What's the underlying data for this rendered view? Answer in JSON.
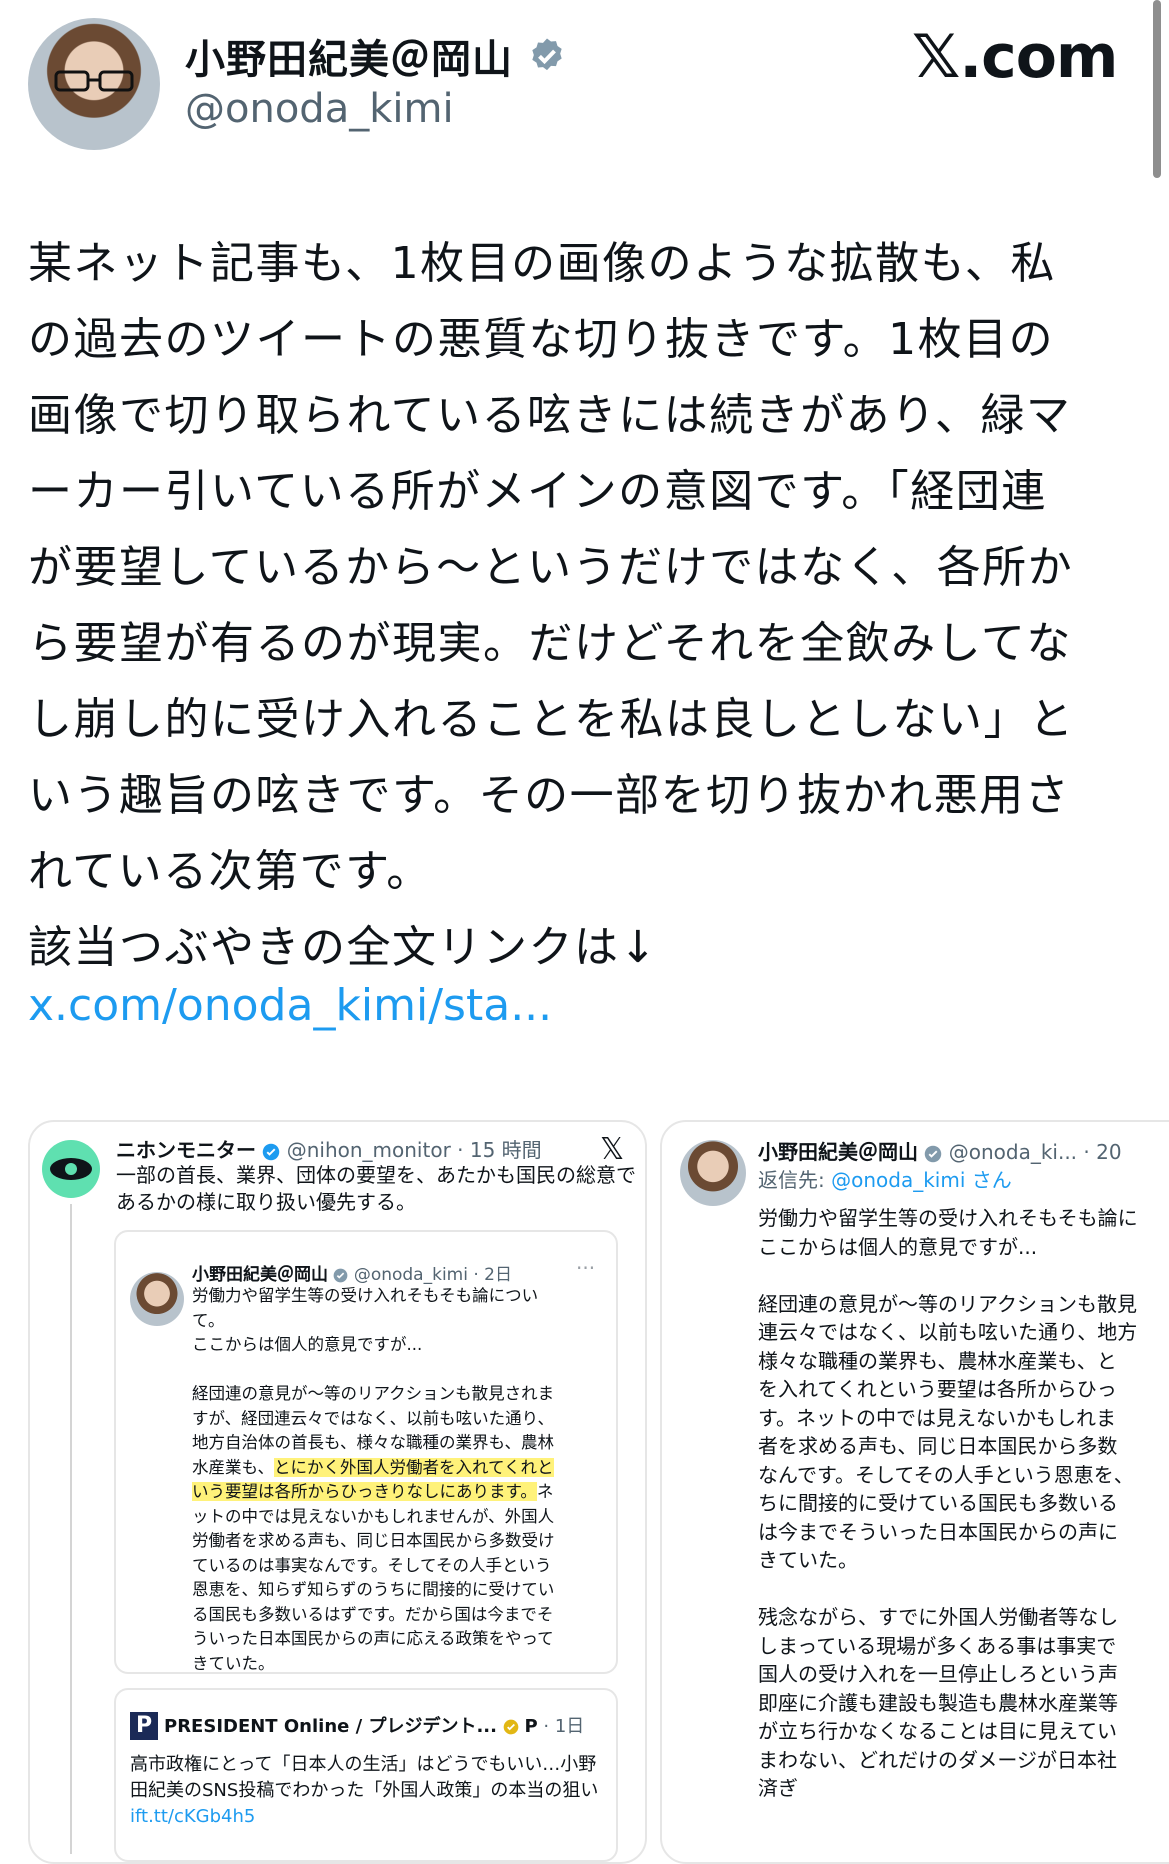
{
  "header": {
    "name": "小野田紀美＠岡山",
    "handle": "@onoda_kimi",
    "site": "𝕏.com"
  },
  "tweet": {
    "text": "某ネット記事も、1枚目の画像のような拡散も、私\nの過去のツイートの悪質な切り抜きです。1枚目の\n画像で切り取られている呟きには続きがあり、緑マ\nーカー引いている所がメインの意図です。「経団連\nが要望しているから〜というだけではなく、各所か\nら要望が有るのが現実。だけどそれを全飲みしてな\nし崩し的に受け入れることを私は良しとしない」と\nいう趣旨の呟きです。その一部を切り抜かれ悪用さ\nれている次第です。\n該当つぶやきの全文リンクは↓",
    "link": "x.com/onoda_kimi/sta..."
  },
  "left_card": {
    "author": "ニホンモニター",
    "handle": "@nihon_monitor",
    "time": "· 15 時間",
    "x_icon": "𝕏",
    "text": "一部の首長、業界、団体の要望を、あたかも国民の総意であるかの様に取り扱い優先する。",
    "quote": {
      "author": "小野田紀美＠岡山",
      "handle": "@onoda_kimi",
      "time": "· 2日",
      "dots": "···",
      "text_before": "労働力や留学生等の受け入れそもそも論につい\nて。\nここからは個人的意見ですが...\n\n経団連の意見が〜等のリアクションも散見されま\nすが、経団連云々ではなく、以前も呟いた通り、\n地方自治体の首長も、様々な職種の業界も、農林\n水産業も、",
      "highlight": "とにかく外国人労働者を入れてくれと\nいう要望は各所からひっきりなしにあります。",
      "text_after": "ネ\nットの中では見えないかもしれませんが、外国人\n労働者を求める声も、同じ日本国民から多数受け\nているのは事実なんです。そしてその人手という\n恩恵を、知らず知らずのうちに間接的に受けてい\nる国民も多数いるはずです。だから国は今までそ\nういった日本国民からの声に応える政策をやって\nきていた。"
    },
    "link_card": {
      "logo": "P",
      "source": "PRESIDENT Online / プレジデント...",
      "badge": "P",
      "time": "· 1日",
      "text": "高市政権にとって「日本人の生活」はどうでもいい…小野田紀美のSNS投稿でわかった「外国人政策」の本当の狙い",
      "url": "ift.tt/cKGb4h5"
    }
  },
  "right_card": {
    "author": "小野田紀美＠岡山",
    "handle": "@onoda_ki...",
    "time": "· 20",
    "reply_prefix": "返信先: ",
    "reply_to": "@onoda_kimi さん",
    "text": "労働力や留学生等の受け入れそもそも論に\nここからは個人的意見ですが...\n\n経団連の意見が〜等のリアクションも散見\n連云々ではなく、以前も呟いた通り、地方\n様々な職種の業界も、農林水産業も、と\nを入れてくれという要望は各所からひっ\nす。ネットの中では見えないかもしれま\n者を求める声も、同じ日本国民から多数\nなんです。そしてその人手という恩恵を、\nちに間接的に受けている国民も多数いる\nは今までそういった日本国民からの声に\nきていた。\n\n残念ながら、すでに外国人労働者等なし\nしまっている現場が多くある事は事実で\n国人の受け入れを一旦停止しろという声\n即座に介護も建設も製造も農林水産業等\nが立ち行かなくなることは目に見えてい\nまわない、どれだけのダメージが日本社\n済ぎ"
  },
  "colors": {
    "link": "#1d9bf0",
    "muted": "#536471",
    "verified": "#829aab",
    "highlight": "#fff27a"
  }
}
